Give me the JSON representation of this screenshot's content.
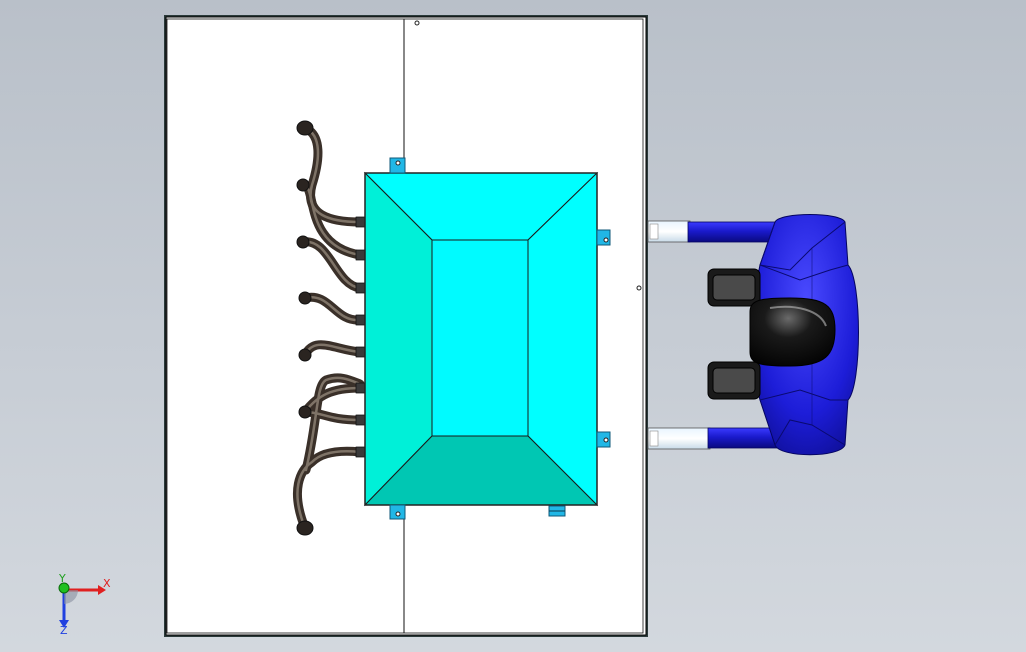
{
  "viewport": {
    "background_top": "#b9c0c9",
    "background_bottom": "#d3d8de"
  },
  "colors": {
    "panel": "#ffffff",
    "panel_outline": "#2a2a2a",
    "tank_light": "#00ffff",
    "tank_left": "#00f0d8",
    "tank_bottom": "#00c7b3",
    "hose": "#4c4238",
    "hose_highlight": "#8a7d70",
    "blower_body": "#1f1fe0",
    "blower_dark": "#0d0d8f",
    "blower_motor": "#0a0a0a",
    "bracket": "#21b7e6",
    "axis_x": "#e02020",
    "axis_y": "#20b020",
    "axis_z": "#2040e0"
  },
  "triad": {
    "x_label": "X",
    "y_label": "Y",
    "z_label": "Z"
  },
  "icons": {
    "triad": "reference-triad-icon"
  }
}
